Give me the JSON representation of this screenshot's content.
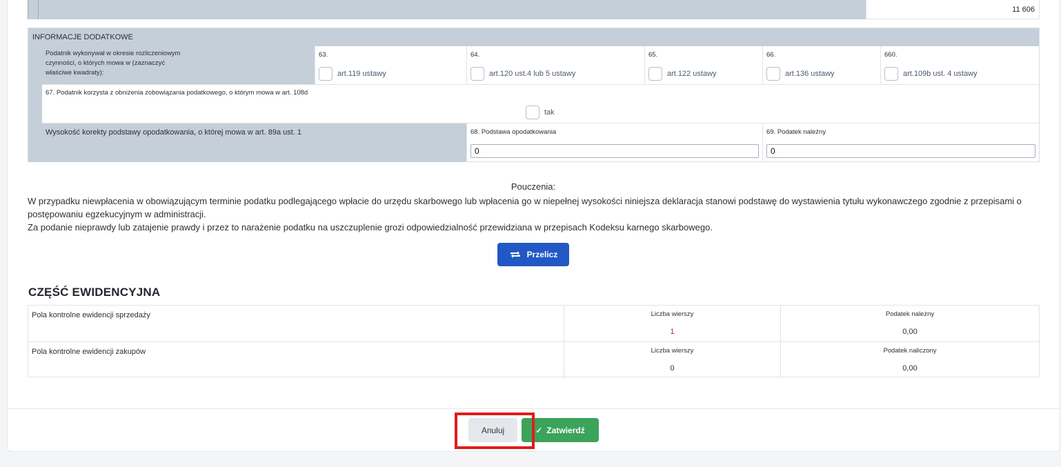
{
  "top_row": {
    "value": "11 606"
  },
  "info": {
    "header": "INFORMACJE DODATKOWE",
    "activity_label": "Podatnik wykonywał w okresie rozliczeniowym czynności, o których mowa w (zaznaczyć właściwe kwadraty):",
    "checkboxes": [
      {
        "num": "63.",
        "label": "art.119 ustawy"
      },
      {
        "num": "64.",
        "label": "art.120 ust.4 lub 5 ustawy"
      },
      {
        "num": "65.",
        "label": "art.122 ustawy"
      },
      {
        "num": "66.",
        "label": "art.136 ustawy"
      },
      {
        "num": "660.",
        "label": "art.109b ust. 4 ustawy"
      }
    ],
    "reduction_label": "67. Podatnik korzysta z obniżenia zobowiązania podatkowego, o którym mowa w art. 108d",
    "reduction_option": "tak",
    "correction_label": "Wysokość korekty podstawy opodatkowania, o której mowa w art. 89a ust. 1",
    "base_label": "68. Podstawa opodatkowania",
    "base_value": "0",
    "tax_label": "69. Podatek należny",
    "tax_value": "0"
  },
  "pouczenia": {
    "title": "Pouczenia:",
    "line1": "W przypadku niewpłacenia w obowiązującym terminie podatku podlegającego wpłacie do urzędu skarbowego lub wpłacenia go w niepełnej wysokości niniejsza deklaracja stanowi podstawę do wystawienia tytułu wykonawczego zgodnie z przepisami o postępowaniu egzekucyjnym w administracji.",
    "line2": "Za podanie nieprawdy lub zatajenie prawdy i przez to narażenie podatku na uszczuplenie grozi odpowiedzialność przewidziana w przepisach Kodeksu karnego skarbowego."
  },
  "recalc_button": "Przelicz",
  "ewidencja": {
    "title": "CZĘŚĆ EWIDENCYJNA",
    "rows": [
      {
        "label": "Pola kontrolne ewidencji sprzedaży",
        "count_header": "Liczba wierszy",
        "count": "1",
        "tax_header": "Podatek należny",
        "tax": "0,00"
      },
      {
        "label": "Pola kontrolne ewidencji zakupów",
        "count_header": "Liczba wierszy",
        "count": "0",
        "tax_header": "Podatek naliczony",
        "tax": "0,00"
      }
    ]
  },
  "footer": {
    "cancel": "Anuluj",
    "confirm": "Zatwierdź"
  },
  "colors": {
    "primary": "#2158c5",
    "success": "#3ba35a",
    "highlight": "#e31b1b",
    "section_gray": "#c5cfd9"
  }
}
